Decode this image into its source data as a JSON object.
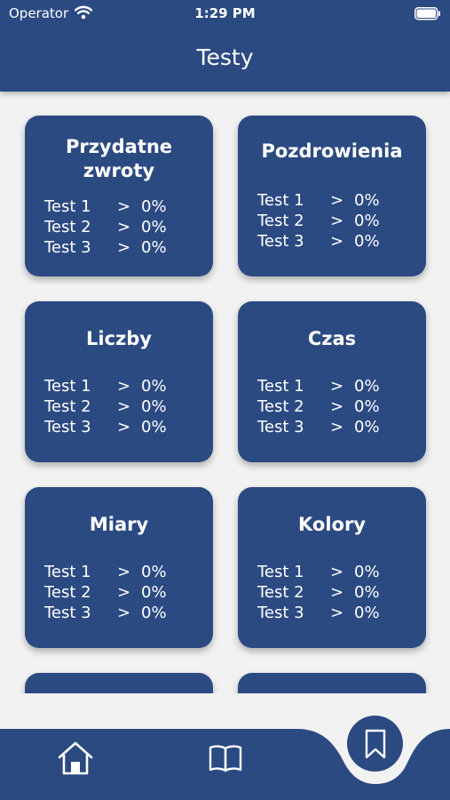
{
  "status_bar": {
    "carrier": "Operator",
    "time": "1:29 PM"
  },
  "header": {
    "title": "Testy"
  },
  "cards": [
    {
      "title": "Przydatne zwroty",
      "tests": [
        {
          "name": "Test 1",
          "arrow": ">",
          "value": "0%"
        },
        {
          "name": "Test 2",
          "arrow": ">",
          "value": "0%"
        },
        {
          "name": "Test 3",
          "arrow": ">",
          "value": "0%"
        }
      ]
    },
    {
      "title": "Pozdrowienia",
      "tests": [
        {
          "name": "Test 1",
          "arrow": ">",
          "value": "0%"
        },
        {
          "name": "Test 2",
          "arrow": ">",
          "value": "0%"
        },
        {
          "name": "Test 3",
          "arrow": ">",
          "value": "0%"
        }
      ]
    },
    {
      "title": "Liczby",
      "tests": [
        {
          "name": "Test 1",
          "arrow": ">",
          "value": "0%"
        },
        {
          "name": "Test 2",
          "arrow": ">",
          "value": "0%"
        },
        {
          "name": "Test 3",
          "arrow": ">",
          "value": "0%"
        }
      ]
    },
    {
      "title": "Czas",
      "tests": [
        {
          "name": "Test 1",
          "arrow": ">",
          "value": "0%"
        },
        {
          "name": "Test 2",
          "arrow": ">",
          "value": "0%"
        },
        {
          "name": "Test 3",
          "arrow": ">",
          "value": "0%"
        }
      ]
    },
    {
      "title": "Miary",
      "tests": [
        {
          "name": "Test 1",
          "arrow": ">",
          "value": "0%"
        },
        {
          "name": "Test 2",
          "arrow": ">",
          "value": "0%"
        },
        {
          "name": "Test 3",
          "arrow": ">",
          "value": "0%"
        }
      ]
    },
    {
      "title": "Kolory",
      "tests": [
        {
          "name": "Test 1",
          "arrow": ">",
          "value": "0%"
        },
        {
          "name": "Test 2",
          "arrow": ">",
          "value": "0%"
        },
        {
          "name": "Test 3",
          "arrow": ">",
          "value": "0%"
        }
      ]
    },
    {
      "title": "",
      "tests": []
    },
    {
      "title": "",
      "tests": []
    }
  ],
  "bottom_nav": {
    "items": [
      {
        "icon": "home-icon"
      },
      {
        "icon": "book-icon"
      },
      {
        "icon": "bookmark-icon",
        "active": true
      }
    ]
  },
  "colors": {
    "primary": "#2b4a82",
    "background": "#f2f2f2",
    "text": "#ffffff"
  }
}
